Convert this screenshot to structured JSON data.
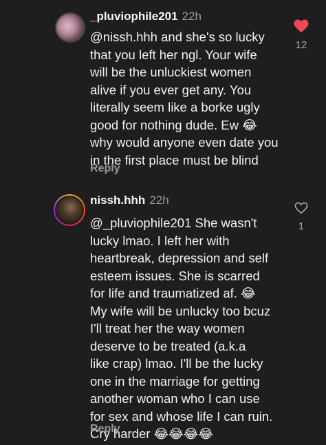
{
  "comments": [
    {
      "username": "_pluviophile201",
      "time": "22h",
      "text": "@nissh.hhh and she's so lucky\nthat you left her ngl. Your wife\nwill be the unluckiest women\nalive if you ever get any. You\nliterally seem like a borke ugly\ngood for nothing dude. Ew 😂\nwhy would anyone even date you\nin the first place must be blind",
      "reply_label": "Reply",
      "likes": "12",
      "liked": true
    },
    {
      "username": "nissh.hhh",
      "time": "22h",
      "text": "@_pluviophile201 She wasn't\nlucky lmao. I left her with\nheartbreak, depression and self\nesteem issues. She is scarred\nfor life and traumatized af. 😂\nMy wife will be unlucky too bcuz\nI'll treat her the way women\ndeserve to be treated (a.k.a\nlike crap) lmao. I'll be the lucky\none in the marriage for getting\nanother woman who I can use\nfor sex and whose life I can ruin.\nCry harder 😂😂😂😂",
      "reply_label": "Reply",
      "likes": "1",
      "liked": false
    }
  ],
  "icons": {
    "heart_filled": "heart-filled-icon",
    "heart_outline": "heart-outline-icon"
  },
  "colors": {
    "background": "#1e1e1e",
    "like_red": "#ed4956",
    "muted": "#9a9a9a"
  }
}
